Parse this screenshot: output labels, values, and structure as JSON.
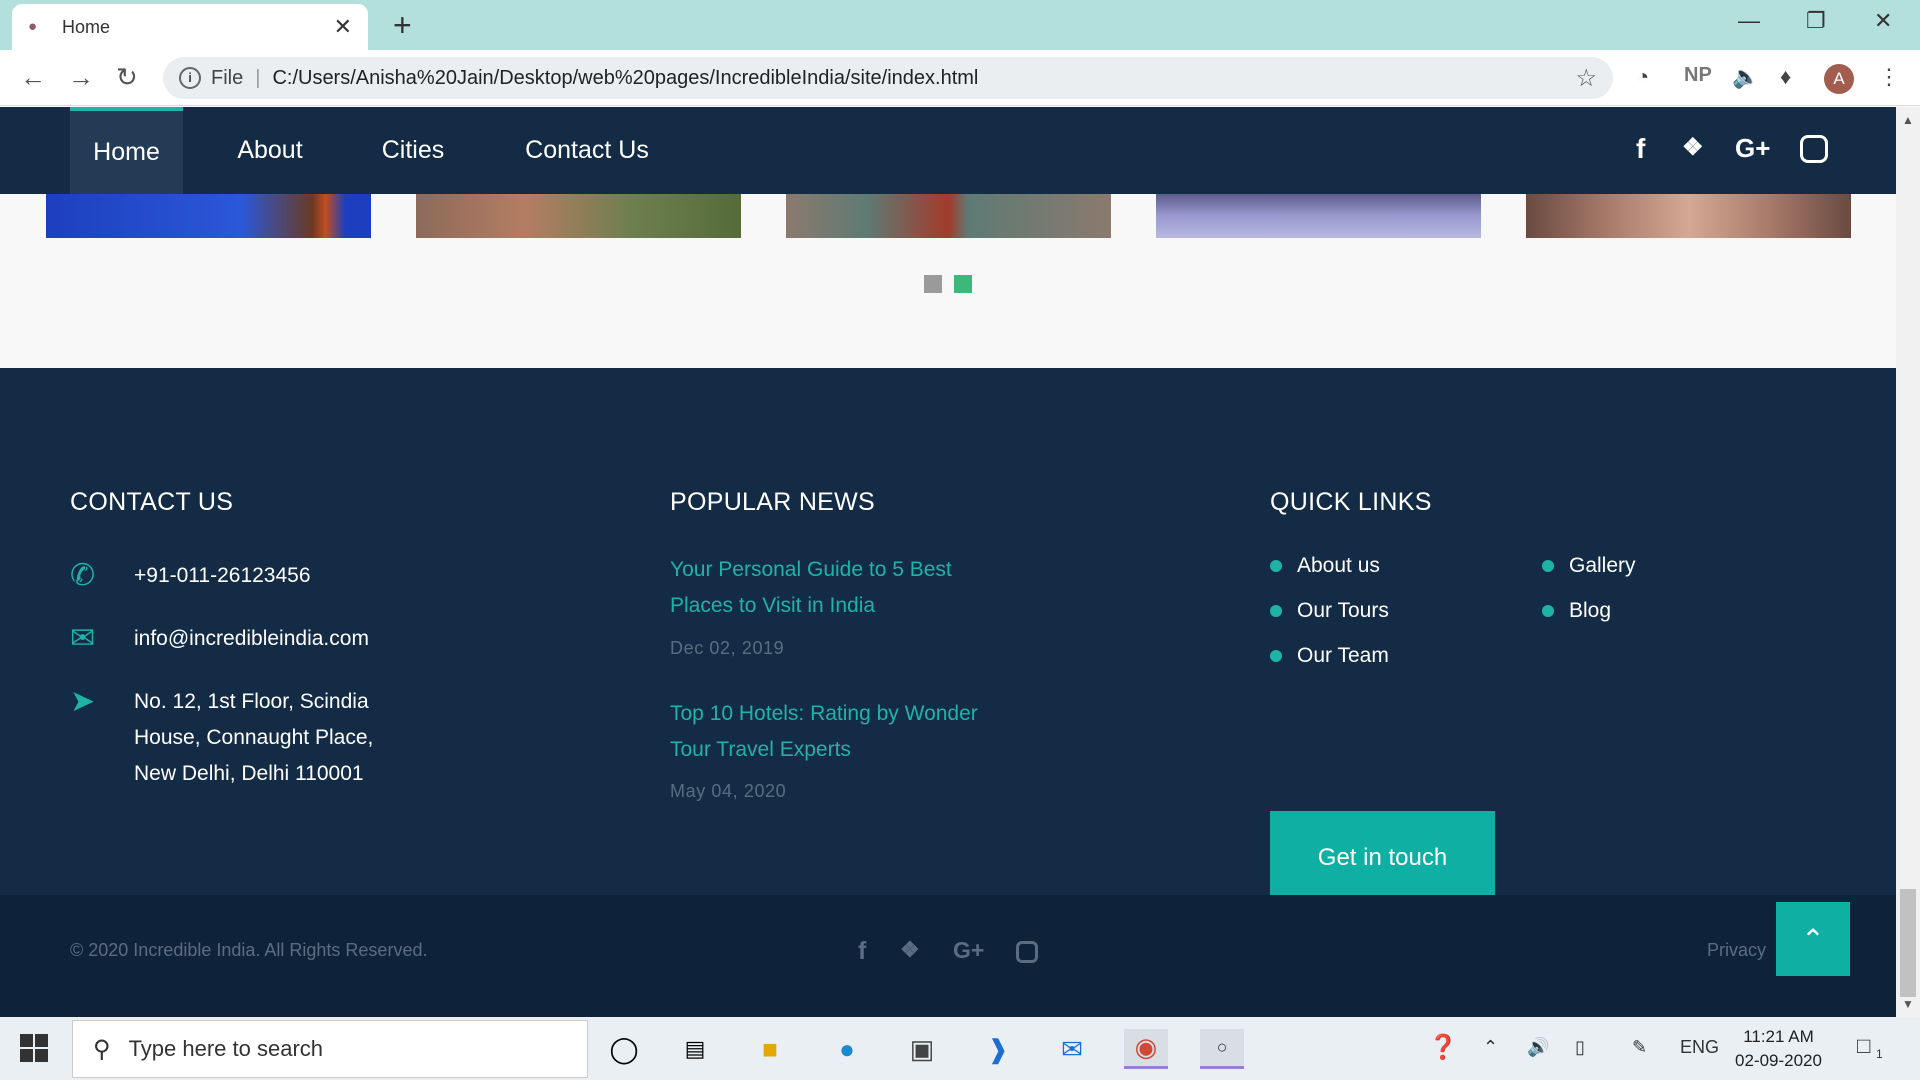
{
  "browser": {
    "tab_title": "Home",
    "url_prefix": "File",
    "url": "C:/Users/Anisha%20Jain/Desktop/web%20pages/IncredibleIndia/site/index.html",
    "extension_np": "NP",
    "avatar_letter": "A"
  },
  "nav": {
    "items": [
      {
        "label": "Home"
      },
      {
        "label": "About"
      },
      {
        "label": "Cities"
      },
      {
        "label": "Contact Us"
      }
    ],
    "social": [
      "f",
      "t",
      "G+",
      "ig"
    ]
  },
  "footer": {
    "contact": {
      "heading": "CONTACT US",
      "phone": "+91-011-26123456",
      "email": "info@incredibleindia.com",
      "address_lines": [
        "No. 12, 1st Floor, Scindia",
        "House, Connaught Place,",
        "New Delhi, Delhi 110001"
      ]
    },
    "news": {
      "heading": "POPULAR NEWS",
      "items": [
        {
          "title_lines": [
            "Your Personal Guide to 5 Best",
            "Places to Visit in India"
          ],
          "date": "Dec 02, 2019"
        },
        {
          "title_lines": [
            "Top 10 Hotels: Rating by Wonder",
            "Tour Travel Experts"
          ],
          "date": "May 04, 2020"
        }
      ]
    },
    "quick_links": {
      "heading": "QUICK LINKS",
      "col1": [
        "About us",
        "Our Tours",
        "Our Team"
      ],
      "col2": [
        "Gallery",
        "Blog"
      ],
      "cta": "Get in touch"
    }
  },
  "bottom": {
    "copyright": "© 2020 Incredible India. All Rights Reserved.",
    "privacy": "Privacy"
  },
  "taskbar": {
    "search_placeholder": "Type here to search",
    "language": "ENG",
    "time": "11:21 AM",
    "date": "02-09-2020",
    "notification_count": "1"
  },
  "colors": {
    "accent": "#1fb3a8",
    "nav_bg": "#142b45",
    "footer_bottom_bg": "#0e2239",
    "muted_text": "#5a6d80"
  }
}
